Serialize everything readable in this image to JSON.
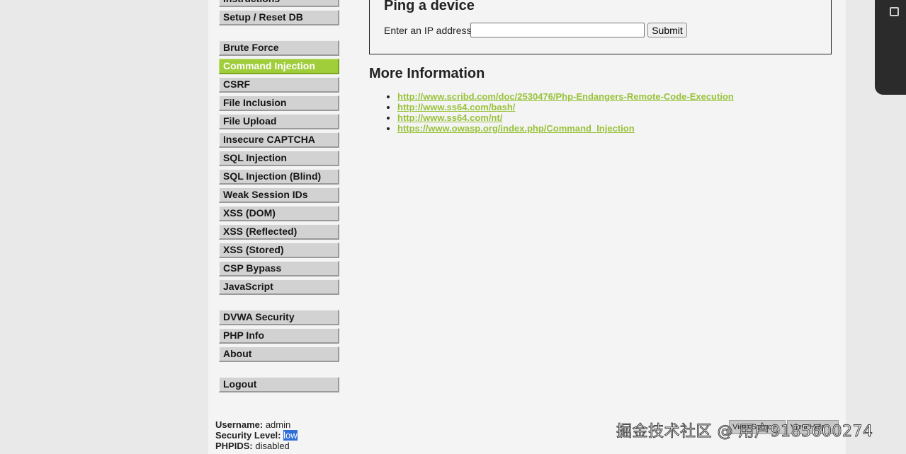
{
  "menu": {
    "group1": [
      "Instructions",
      "Setup / Reset DB"
    ],
    "group2": [
      "Brute Force",
      "Command Injection",
      "CSRF",
      "File Inclusion",
      "File Upload",
      "Insecure CAPTCHA",
      "SQL Injection",
      "SQL Injection (Blind)",
      "Weak Session IDs",
      "XSS (DOM)",
      "XSS (Reflected)",
      "XSS (Stored)",
      "CSP Bypass",
      "JavaScript"
    ],
    "group3": [
      "DVWA Security",
      "PHP Info",
      "About"
    ],
    "group4": [
      "Logout"
    ],
    "active": "Command Injection"
  },
  "vuln": {
    "title": "Ping a device",
    "ip_label": "Enter an IP address:",
    "ip_value": "",
    "submit_label": "Submit"
  },
  "more_info": {
    "title": "More Information",
    "links": [
      "http://www.scribd.com/doc/2530476/Php-Endangers-Remote-Code-Execution",
      "http://www.ss64.com/bash/",
      "http://www.ss64.com/nt/",
      "https://www.owasp.org/index.php/Command_Injection"
    ]
  },
  "footer": {
    "username_label": "Username:",
    "username": "admin",
    "security_label": "Security Level:",
    "security": "low",
    "phpids_label": "PHPIDS:",
    "phpids": "disabled",
    "view_source": "View Source",
    "view_help": "View Help"
  },
  "watermark": "掘金技术社区 @ 用户9185600274",
  "colors": {
    "accent": "#a0cd3a",
    "link": "#99c23a",
    "menu_bg": "#d2d2d2"
  },
  "side_panel_icon": "square-icon"
}
